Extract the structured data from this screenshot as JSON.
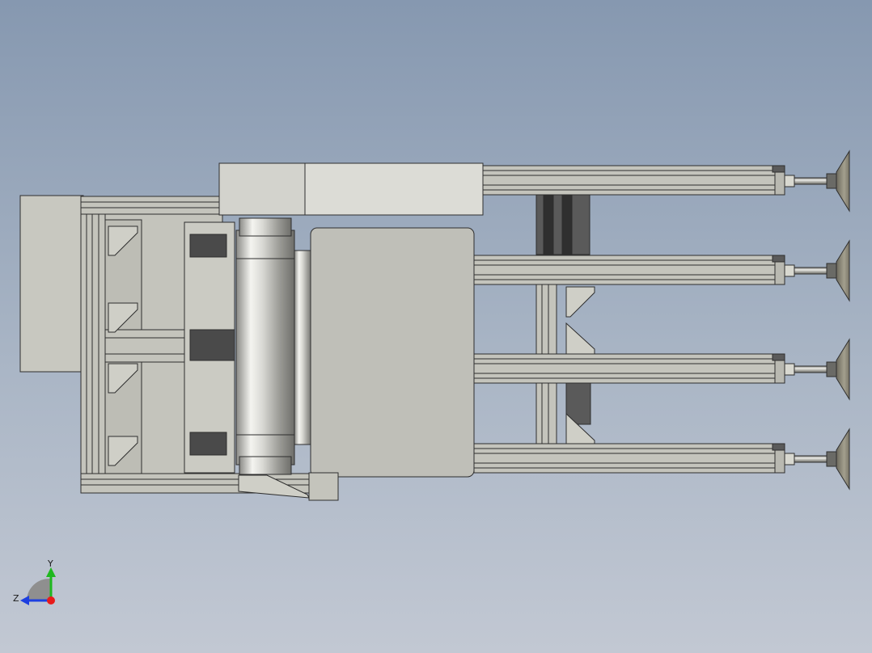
{
  "viewport": {
    "background_top": "#8698b0",
    "background_bottom": "#c2c8d3"
  },
  "model": {
    "description_icon": "cad-assembly-gripper",
    "frame_color": "#c4c4bc",
    "edge_color": "#2e2e2e",
    "dark_part_color": "#4a4a4a",
    "suction_cup_count": 4
  },
  "triad": {
    "x_color": "#e81a1a",
    "y_color": "#1fb81f",
    "z_color": "#1d3fe0",
    "y_label": "Y",
    "z_label": "Z"
  }
}
